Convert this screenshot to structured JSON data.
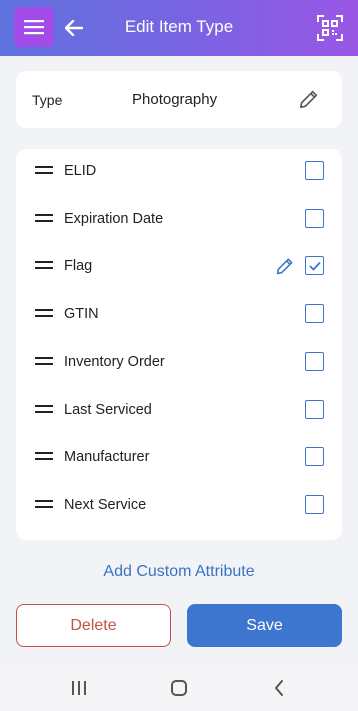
{
  "header": {
    "title": "Edit Item Type",
    "background": "#7a63e3",
    "menu_button_color": "#a24be8",
    "icons": {
      "menu": "menu-icon",
      "back": "back-arrow-icon",
      "scan": "qr-scan-icon"
    }
  },
  "type_field": {
    "label": "Type",
    "value": "Photography",
    "edit_icon": "pencil-icon"
  },
  "attributes": [
    {
      "label": "ELID",
      "checked": false,
      "editable": false
    },
    {
      "label": "Expiration Date",
      "checked": false,
      "editable": false
    },
    {
      "label": "Flag",
      "checked": true,
      "editable": true
    },
    {
      "label": "GTIN",
      "checked": false,
      "editable": false
    },
    {
      "label": "Inventory Order",
      "checked": false,
      "editable": false
    },
    {
      "label": "Last Serviced",
      "checked": false,
      "editable": false
    },
    {
      "label": "Manufacturer",
      "checked": false,
      "editable": false
    },
    {
      "label": "Next Service",
      "checked": false,
      "editable": false
    }
  ],
  "add_custom_attribute_label": "Add Custom Attribute",
  "buttons": {
    "delete_label": "Delete",
    "save_label": "Save"
  },
  "colors": {
    "accent": "#3d75cf",
    "danger": "#c4524a",
    "checkbox": "#3a76c9"
  },
  "navbar": {
    "icons": [
      "recent-apps-icon",
      "home-icon",
      "back-icon"
    ]
  }
}
